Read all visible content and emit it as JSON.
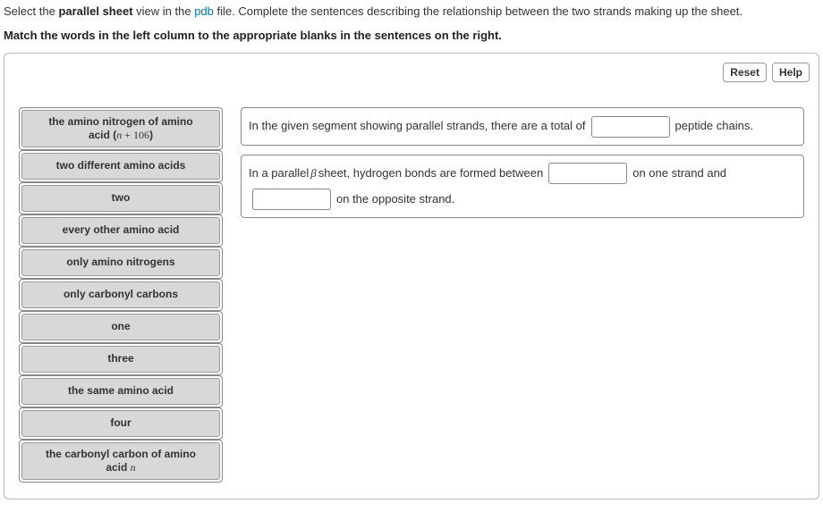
{
  "question": {
    "prefix": "Select the ",
    "bold1": "parallel sheet",
    "mid1": " view in the ",
    "link": "pdb",
    "tail": " file. Complete the sentences describing the relationship between the two strands making up the sheet."
  },
  "instruction": "Match the words in the left column to the appropriate blanks in the sentences on the right.",
  "buttons": {
    "reset": "Reset",
    "help": "Help"
  },
  "tiles": {
    "t0a": "the amino nitrogen of amino",
    "t0b_prefix": "acid (",
    "t0b_n": "n",
    "t0b_plus": " + 106",
    "t0b_suffix": ")",
    "t1": "two different amino acids",
    "t2": "two",
    "t3": "every other amino acid",
    "t4": "only amino nitrogens",
    "t5": "only carbonyl carbons",
    "t6": "one",
    "t7": "three",
    "t8": "the same amino acid",
    "t9": "four",
    "t10a": "the carbonyl carbon of amino",
    "t10b_prefix": "acid ",
    "t10b_n": "n"
  },
  "sentence1": {
    "p1": "In the given segment showing parallel strands, there are a total of ",
    "p2": " peptide chains."
  },
  "sentence2": {
    "p1": "In a parallel ",
    "beta": "β",
    "p2": " sheet, hydrogen bonds are formed between ",
    "p3": " on one strand and ",
    "p4": " on the opposite strand."
  }
}
